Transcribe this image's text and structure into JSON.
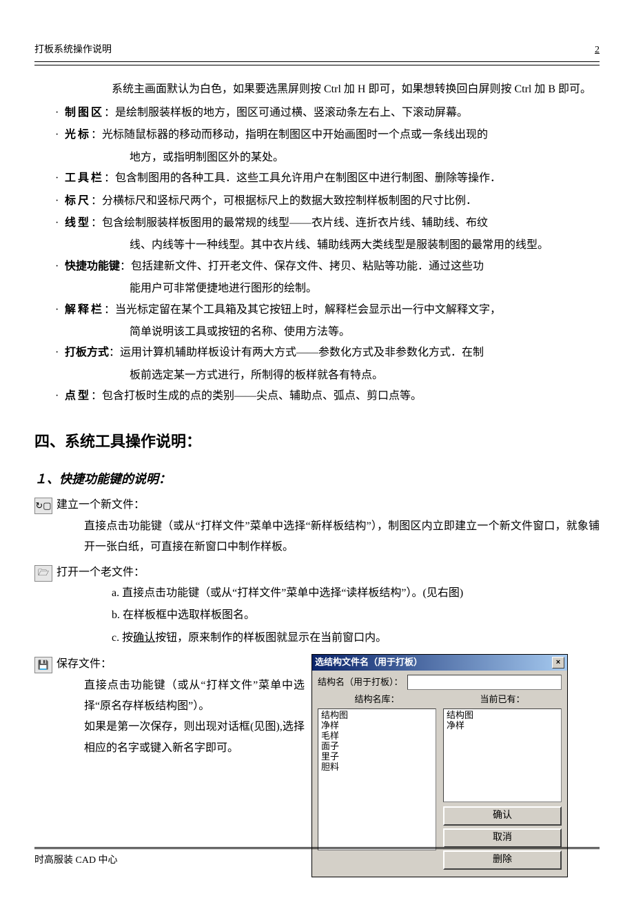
{
  "header": {
    "title": "打板系统操作说明",
    "page": "2"
  },
  "intro": "系统主画面默认为白色，如果要选黑屏则按 Ctrl 加 H 即可，如果想转换回白屏则按 Ctrl 加 B 即可。",
  "bullets": [
    {
      "label": "制图区",
      "text": "：是绘制服装样板的地方，图区可通过横、竖滚动条左右上、下滚动屏幕。"
    },
    {
      "label": "光标",
      "text": "：光标随鼠标器的移动而移动，指明在制图区中开始画图时一个点或一条线出现的",
      "cont": "地方，或指明制图区外的某处。"
    },
    {
      "label": "工具栏",
      "text": "：包含制图用的各种工具．这些工具允许用户在制图区中进行制图、删除等操作．"
    },
    {
      "label": "标尺",
      "text": "：分横标尺和竖标尺两个，可根据标尺上的数据大致控制样板制图的尺寸比例．"
    },
    {
      "label": "线型",
      "text": "：包含绘制服装样板图用的最常规的线型——衣片线、连折衣片线、辅助线、布纹",
      "cont": "线、内线等十一种线型。其中衣片线、辅助线两大类线型是服装制图的最常用的线型。"
    },
    {
      "label": "快捷功能键",
      "ls": "nls",
      "text": "：包括建新文件、打开老文件、保存文件、拷贝、粘贴等功能．通过这些功",
      "cont": "能用户可非常便捷地进行图形的绘制。"
    },
    {
      "label": "解释栏",
      "text": "：当光标定留在某个工具箱及其它按钮上时，解释栏会显示出一行中文解释文字，",
      "cont": "简单说明该工具或按钮的名称、使用方法等。"
    },
    {
      "label": "打板方式",
      "ls": "nls",
      "text": "：运用计算机辅助样板设计有两大方式——参数化方式及非参数化方式．在制",
      "cont": "板前选定某一方式进行，所制得的板样就各有特点。"
    },
    {
      "label": "点型",
      "text": "：包含打板时生成的点的类别——尖点、辅助点、弧点、剪口点等。"
    }
  ],
  "h2": "四、系统工具操作说明：",
  "h3": "１、快捷功能键的说明：",
  "icons": [
    {
      "glyph": "↻▢",
      "name": "new-file-icon",
      "title": "建立一个新文件：",
      "body": "直接点击功能键（或从“打样文件”菜单中选择“新样板结构”），制图区内立即建立一个新文件窗口，就象铺开一张白纸，可直接在新窗口中制作样板。"
    },
    {
      "glyph": "🗁",
      "name": "open-file-icon",
      "title": "打开一个老文件：",
      "abc": [
        "直接点击功能键（或从“打样文件”菜单中选择“读样板结构”）。(见右图)",
        "在样板框中选取样板图名。",
        "按确认按钮，原来制作的样板图就显示在当前窗口内。"
      ]
    },
    {
      "glyph": "💾",
      "name": "save-file-icon",
      "title": "保存文件：",
      "left": [
        "直接点击功能键（或从“打样文件”菜单中选择“原名存样板结构图”）。",
        "如果是第一次保存，则出现对话框(见图),选择相应的名字或键入新名字即可。"
      ]
    }
  ],
  "dialog": {
    "title": "选结构文件名（用于打板）",
    "fieldLabel": "结构名（用于打板）：",
    "libLabel": "结构名库：",
    "curLabel": "当前已有：",
    "libItems": [
      "结构图",
      "净样",
      "毛样",
      "面子",
      "里子",
      "胆料"
    ],
    "curItems": [
      "结构图",
      "净样"
    ],
    "buttons": {
      "ok": "确认",
      "cancel": "取消",
      "delete": "删除"
    }
  },
  "footer": "时高服装 CAD 中心"
}
